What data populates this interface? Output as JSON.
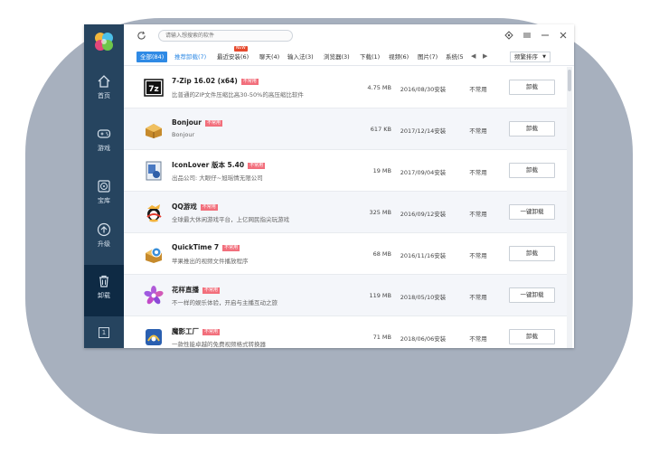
{
  "search": {
    "placeholder": "请输入想搜索的软件"
  },
  "sidebar": {
    "items": [
      {
        "label": "首页",
        "icon": "home-icon"
      },
      {
        "label": "游戏",
        "icon": "gamepad-icon"
      },
      {
        "label": "宝库",
        "icon": "disc-icon"
      },
      {
        "label": "升级",
        "icon": "upgrade-arrow-icon"
      },
      {
        "label": "卸载",
        "icon": "trash-icon",
        "active": true
      }
    ],
    "badge": "1"
  },
  "tabs": [
    {
      "label": "全部(84)",
      "active": true
    },
    {
      "label": "推荐卸载(7)"
    },
    {
      "label": "最近安装(6)",
      "badge": "NEW"
    },
    {
      "label": "聊天(4)"
    },
    {
      "label": "输入法(3)"
    },
    {
      "label": "浏览器(3)"
    },
    {
      "label": "下载(1)"
    },
    {
      "label": "视频(6)"
    },
    {
      "label": "图片(7)"
    },
    {
      "label": "系统(5"
    }
  ],
  "sort_label": "频繁排序",
  "apps": [
    {
      "name": "7-Zip 16.02 (x64)",
      "tag": "不常用",
      "desc": "比普通的ZIP文件压缩比高30-50%的高压缩比软件",
      "size": "4.75 MB",
      "date": "2016/08/30安装",
      "freq": "不常用",
      "button": "卸载",
      "icon": "7zip-icon"
    },
    {
      "name": "Bonjour",
      "tag": "不常用",
      "desc": "Bonjour",
      "size": "617 KB",
      "date": "2017/12/14安装",
      "freq": "不常用",
      "button": "卸载",
      "icon": "bonjour-icon"
    },
    {
      "name": "IconLover 版本 5.40",
      "tag": "不常用",
      "desc": "出品公司: 大眼仔~旭瑶情无限公司",
      "size": "19 MB",
      "date": "2017/09/04安装",
      "freq": "不常用",
      "button": "卸载",
      "icon": "iconlover-icon"
    },
    {
      "name": "QQ游戏",
      "tag": "不常用",
      "desc": "全球最大休闲游戏平台，上亿网民指尖玩游戏",
      "size": "325 MB",
      "date": "2016/09/12安装",
      "freq": "不常用",
      "button": "一键卸载",
      "icon": "qq-game-icon"
    },
    {
      "name": "QuickTime 7",
      "tag": "不常用",
      "desc": "苹果推出的视频文件播放程序",
      "size": "68 MB",
      "date": "2016/11/16安装",
      "freq": "不常用",
      "button": "卸载",
      "icon": "quicktime-icon"
    },
    {
      "name": "花样直播",
      "tag": "不常用",
      "desc": "不一样的娱乐体验，开启与主播互动之旅",
      "size": "119 MB",
      "date": "2018/05/10安装",
      "freq": "不常用",
      "button": "一键卸载",
      "icon": "flower-live-icon"
    },
    {
      "name": "魔影工厂",
      "tag": "不常用",
      "desc": "一款性能卓越的免费视频格式转换器",
      "size": "71 MB",
      "date": "2018/06/06安装",
      "freq": "不常用",
      "button": "卸载",
      "icon": "video-factory-icon"
    }
  ]
}
